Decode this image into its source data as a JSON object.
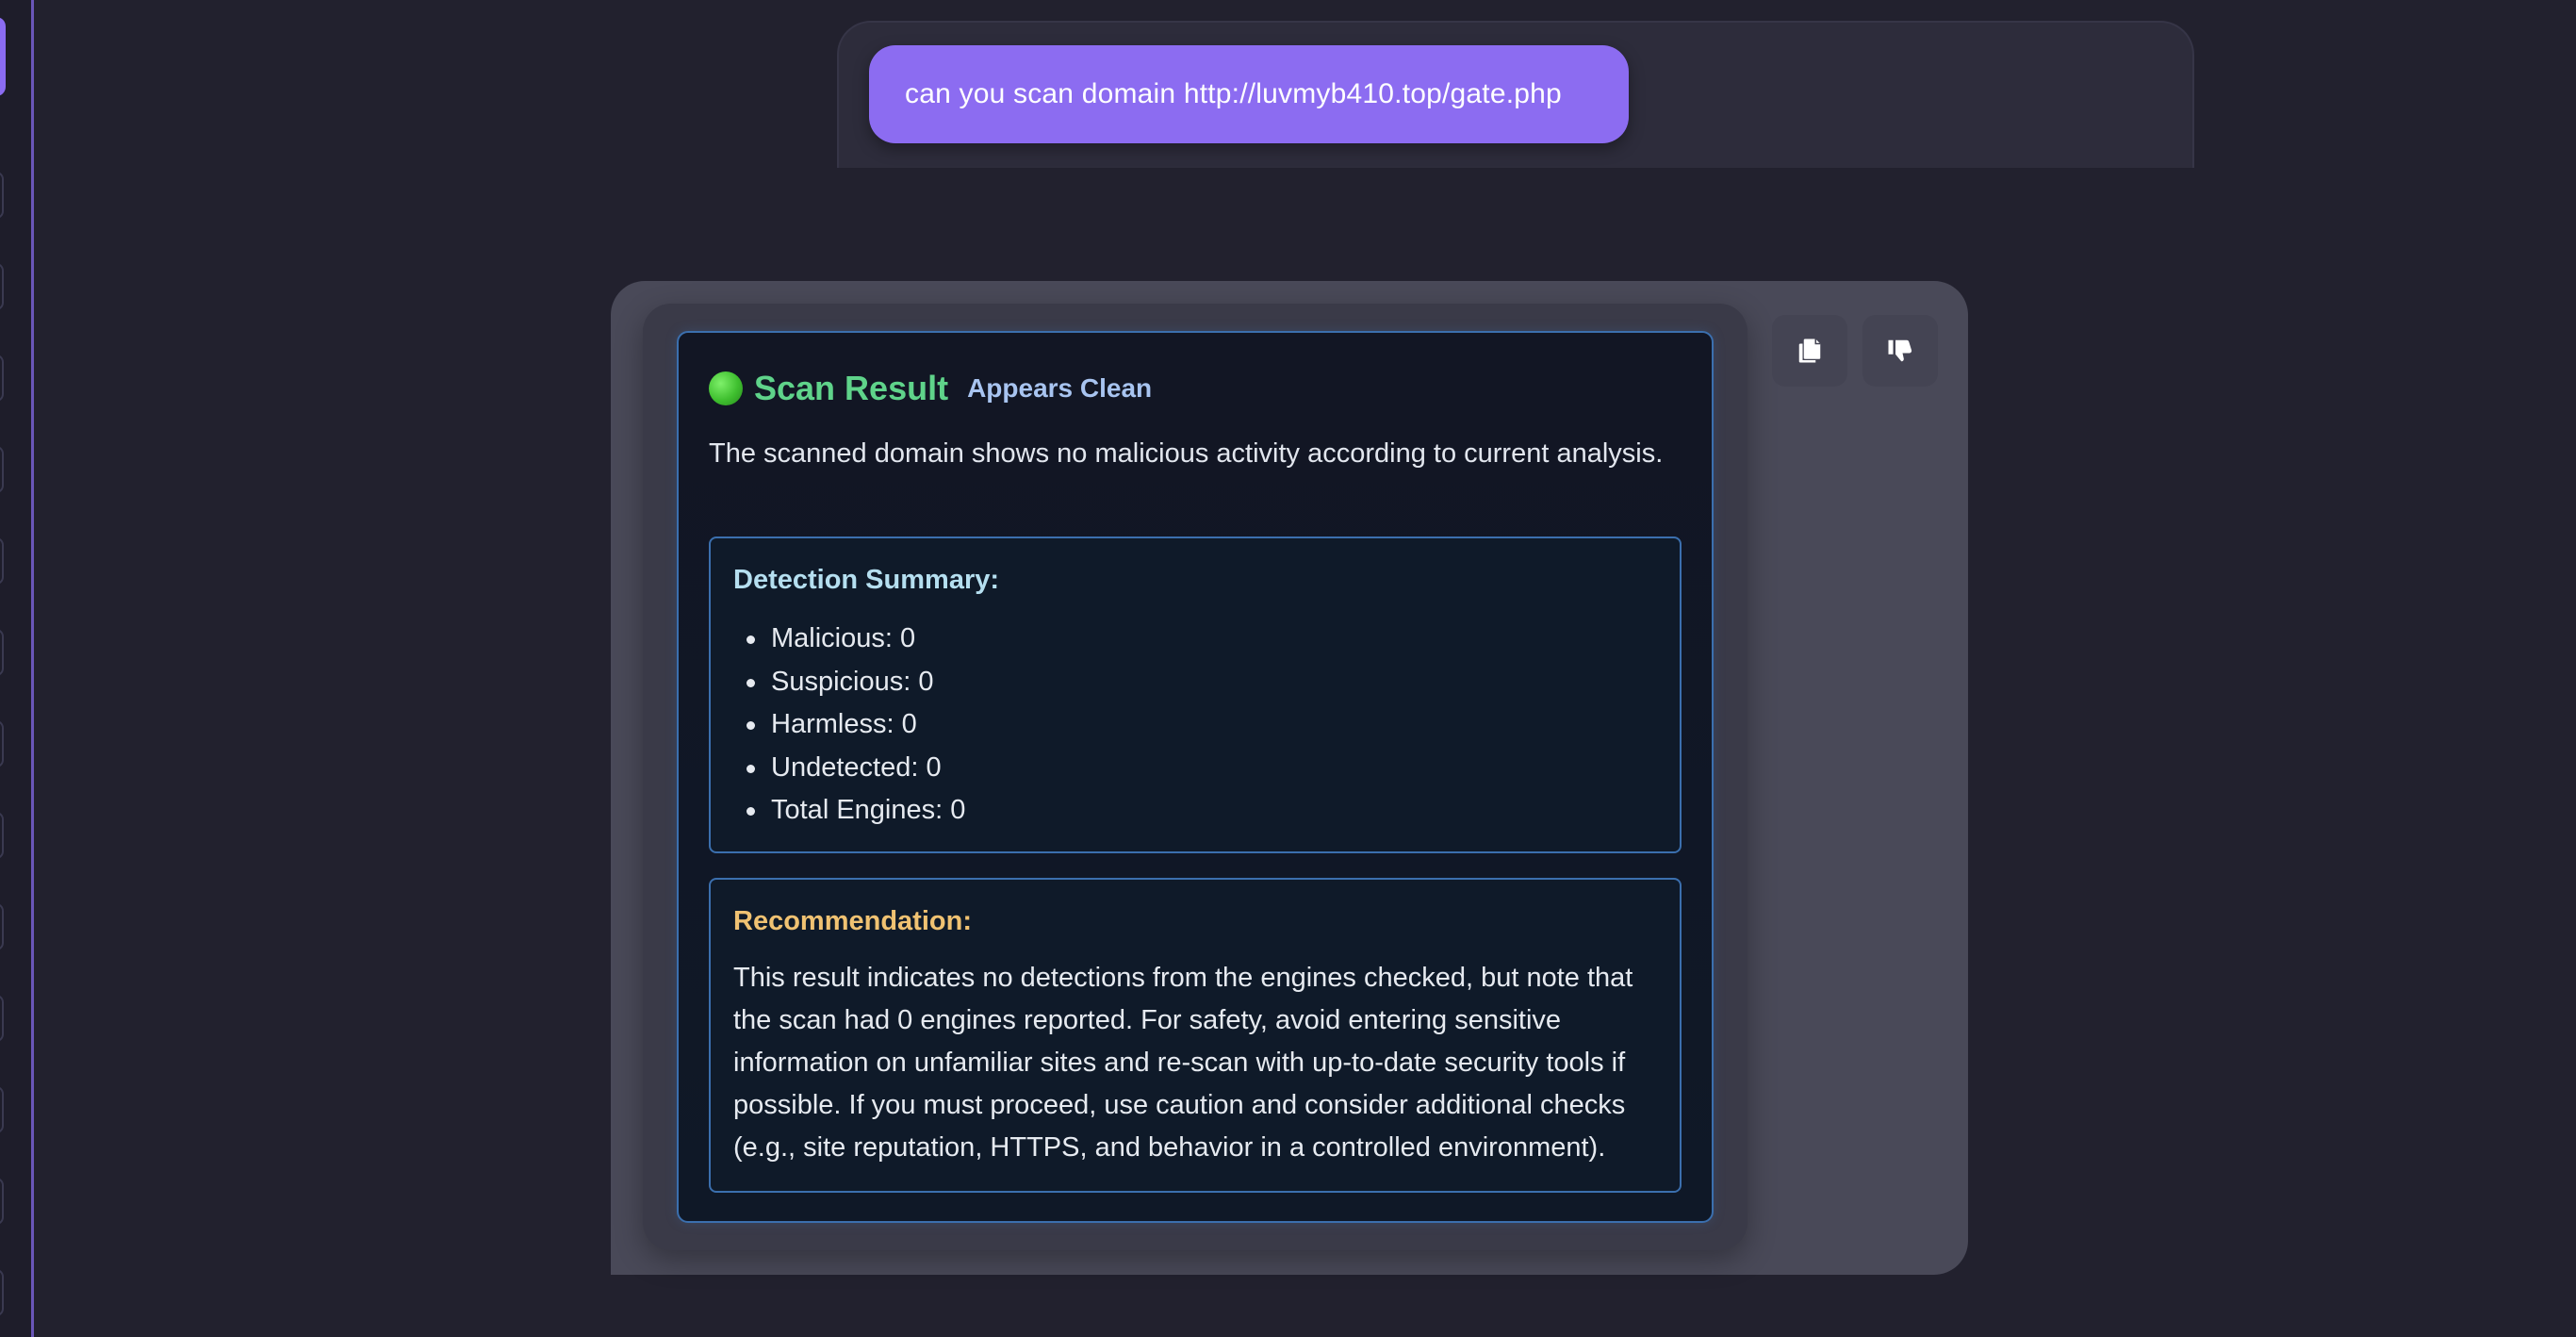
{
  "user_message": {
    "text": "can you scan domain http://luvmyb410.top/gate.php"
  },
  "assistant": {
    "actions": {
      "copy_icon": "copy-icon",
      "dislike_icon": "thumbs-down-icon"
    },
    "scan_result": {
      "status_indicator": "🟢",
      "title": "Scan Result",
      "status": "Appears Clean",
      "description": "The scanned domain shows no malicious activity according to current analysis.",
      "detection_summary": {
        "title": "Detection Summary:",
        "items": [
          "Malicious: 0",
          "Suspicious: 0",
          "Harmless: 0",
          "Undetected: 0",
          "Total Engines: 0"
        ]
      },
      "recommendation": {
        "title": "Recommendation:",
        "text": "This result indicates no detections from the engines checked, but note that the scan had 0 engines reported. For safety, avoid entering sensitive information on unfamiliar sites and re-scan with up-to-date security tools if possible. If you must proceed, use caution and consider additional checks (e.g., site reputation, HTTPS, and behavior in a controlled environment)."
      }
    }
  },
  "colors": {
    "background": "#22212e",
    "accent": "#8c6cf1",
    "clean_green": "#5fd38a",
    "border_blue": "#3b6fae",
    "recommendation_gold": "#f0c272"
  }
}
